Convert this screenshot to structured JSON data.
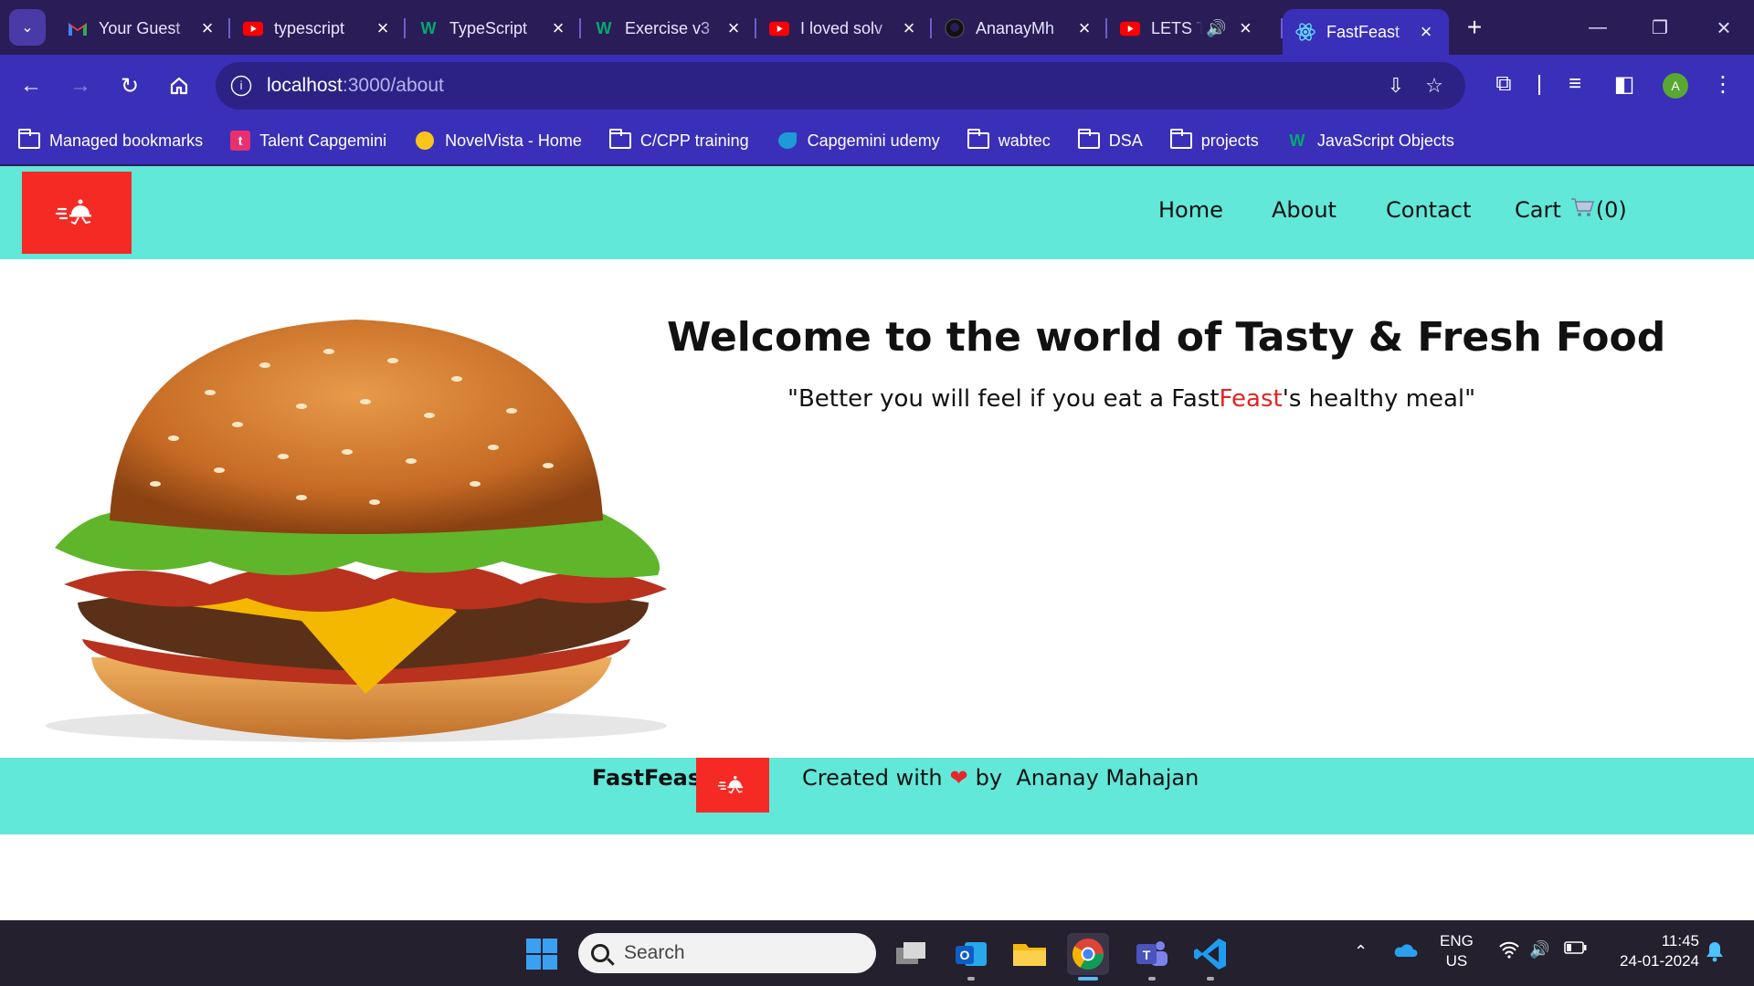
{
  "browser": {
    "tabs": [
      {
        "title": "Your Guest",
        "icon": "gmail-icon",
        "color": "#ea4335"
      },
      {
        "title": "typescript",
        "icon": "youtube-icon",
        "color": "#ff0000"
      },
      {
        "title": "TypeScript",
        "icon": "w3schools-icon",
        "color": "#04aa6d"
      },
      {
        "title": "Exercise v3",
        "icon": "w3schools-icon",
        "color": "#04aa6d"
      },
      {
        "title": "I loved solv",
        "icon": "youtube-icon",
        "color": "#ff0000"
      },
      {
        "title": "AnanayMh",
        "icon": "github-icon",
        "color": "#111111"
      },
      {
        "title": "LETS TA",
        "icon": "youtube-icon",
        "color": "#ff0000"
      },
      {
        "title": "FastFeast",
        "icon": "react-icon",
        "color": "#61dafb"
      }
    ],
    "url_host": "localhost",
    "url_path": ":3000/about",
    "profile_initial": "A",
    "bookmarks": [
      {
        "label": "Managed bookmarks",
        "icon": "managed-folder-icon"
      },
      {
        "label": "Talent Capgemini",
        "icon": "talent-icon"
      },
      {
        "label": "NovelVista - Home",
        "icon": "novelvista-icon"
      },
      {
        "label": "C/CPP training",
        "icon": "folder-icon"
      },
      {
        "label": "Capgemini udemy",
        "icon": "capgemini-icon"
      },
      {
        "label": "wabtec",
        "icon": "folder-icon"
      },
      {
        "label": "DSA",
        "icon": "folder-icon"
      },
      {
        "label": "projects",
        "icon": "folder-icon"
      },
      {
        "label": "JavaScript Objects",
        "icon": "w3schools-icon"
      }
    ]
  },
  "site": {
    "nav": {
      "home": "Home",
      "about": "About",
      "contact": "Contact",
      "cart": "Cart",
      "cart_count": "(0)"
    },
    "hero": {
      "title": "Welcome to the world of Tasty & Fresh Food",
      "quote_pre": "\"Better you will feel if you eat a Fast",
      "quote_red": "Feast",
      "quote_post": "'s healthy meal\""
    },
    "footer": {
      "brand": "FastFeast",
      "created_with": "Created with",
      "by": "by",
      "author": "Ananay Mahajan"
    },
    "colors": {
      "accent": "#61e8d8",
      "logo_red": "#f52a25",
      "highlight": "#e52222"
    }
  },
  "taskbar": {
    "search_placeholder": "Search",
    "lang_top": "ENG",
    "lang_bottom": "US",
    "time": "11:45",
    "date": "24-01-2024"
  }
}
